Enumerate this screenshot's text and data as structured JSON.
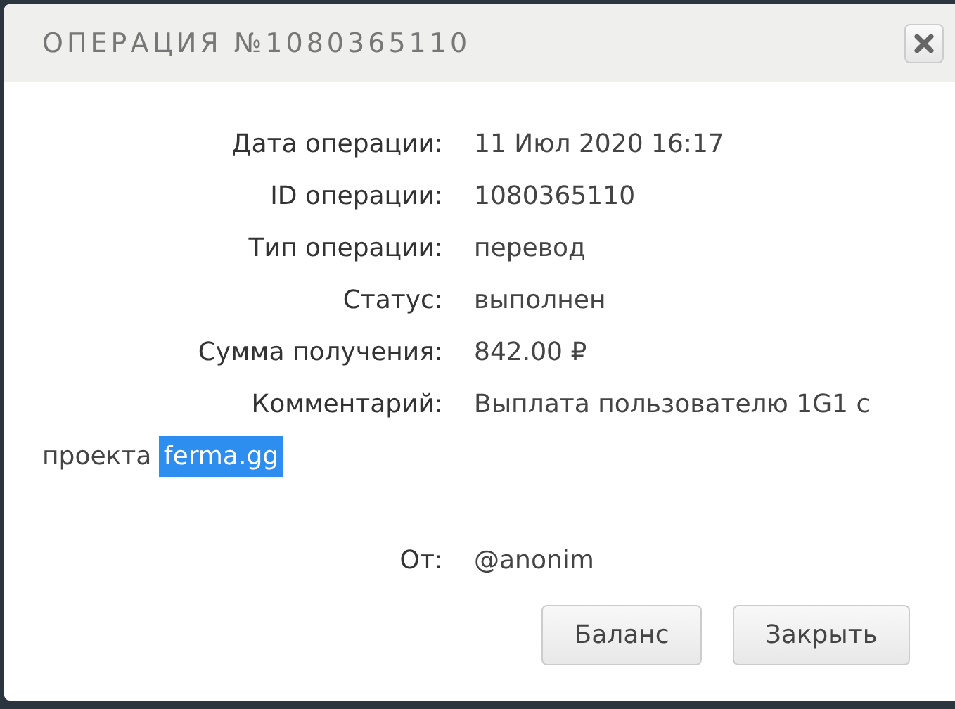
{
  "window": {
    "title": "ОПЕРАЦИЯ №1080365110"
  },
  "details": [
    {
      "label": "Дата операции:",
      "value": "11 Июл 2020 16:17"
    },
    {
      "label": "ID операции:",
      "value": "1080365110"
    },
    {
      "label": "Тип операции:",
      "value": "перевод"
    },
    {
      "label": "Статус:",
      "value": "выполнен"
    },
    {
      "label": "Сумма получения:",
      "value": "842.00 ₽"
    }
  ],
  "comment": {
    "label": "Комментарий:",
    "first_line": "Выплата пользователю 1G1 с",
    "second_line": "проекта",
    "highlighted": "ferma.gg"
  },
  "sender": {
    "label": "От:",
    "value": "@anonim"
  },
  "buttons": [
    "Баланс",
    "Закрыть"
  ]
}
